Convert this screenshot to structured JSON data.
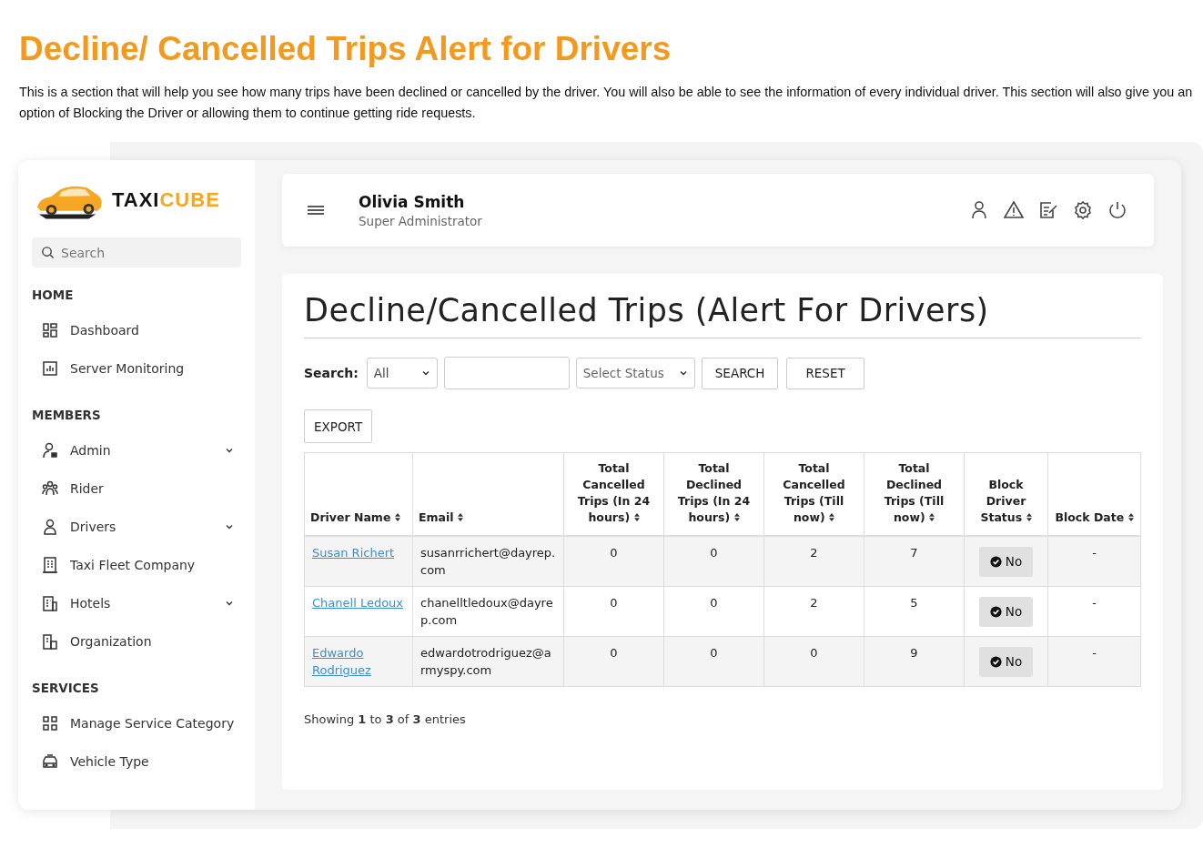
{
  "heading": "Decline/ Cancelled Trips Alert for Drivers",
  "intro": "This is a section that will help you see how many trips have been declined or cancelled by the driver. You will also be able to see the information of every individual driver. This section will also give you an option of Blocking the Driver or allowing them to continue getting ride requests.",
  "sidebar": {
    "brand": {
      "first": "TAXI",
      "second": "CUBE"
    },
    "search": {
      "placeholder": "Search"
    },
    "sections": [
      {
        "title": "HOME",
        "items": [
          {
            "label": "Dashboard",
            "expandable": false
          },
          {
            "label": "Server Monitoring",
            "expandable": false
          }
        ]
      },
      {
        "title": "MEMBERS",
        "items": [
          {
            "label": "Admin",
            "expandable": true
          },
          {
            "label": "Rider",
            "expandable": false
          },
          {
            "label": "Drivers",
            "expandable": true
          },
          {
            "label": "Taxi Fleet Company",
            "expandable": false
          },
          {
            "label": "Hotels",
            "expandable": true
          },
          {
            "label": "Organization",
            "expandable": false
          }
        ]
      },
      {
        "title": "SERVICES",
        "items": [
          {
            "label": "Manage Service Category",
            "expandable": false
          },
          {
            "label": "Vehicle Type",
            "expandable": false
          }
        ]
      }
    ]
  },
  "header": {
    "name": "Olivia Smith",
    "role": "Super Administrator"
  },
  "card": {
    "title": "Decline/Cancelled Trips (Alert For Drivers)",
    "filters": {
      "label": "Search:",
      "scope": "All",
      "status_placeholder": "Select Status",
      "buttons": [
        "SEARCH",
        "RESET"
      ]
    },
    "export": "EXPORT",
    "columns": [
      "Driver Name",
      "Email",
      "Total Cancelled Trips (In 24 hours)",
      "Total Declined Trips (In 24 hours)",
      "Total Cancelled Trips (Till now)",
      "Total Declined Trips (Till now)",
      "Block Driver Status",
      "Block Date"
    ],
    "rows": [
      {
        "name": "Susan Richert",
        "email": "susanrrichert@dayrep.com",
        "c24": "0",
        "d24": "0",
        "call": "2",
        "dall": "7",
        "status": "No",
        "blocked": false,
        "date": "-"
      },
      {
        "name": "Chanell Ledoux",
        "email": "chanelltledoux@dayrep.com",
        "c24": "0",
        "d24": "0",
        "call": "2",
        "dall": "5",
        "status": "No",
        "blocked": false,
        "date": "-"
      },
      {
        "name": "Edwardo Rodriguez",
        "email": "edwardotrodriguez@armyspy.com",
        "c24": "0",
        "d24": "0",
        "call": "0",
        "dall": "9",
        "status": "No",
        "blocked": false,
        "date": "-"
      }
    ],
    "footer": "Showing **1** to **3** of **3** entries"
  }
}
